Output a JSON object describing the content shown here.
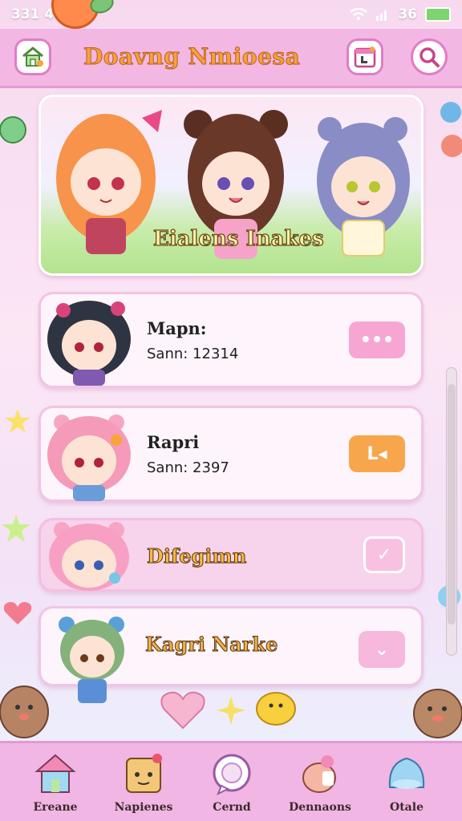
{
  "status_bar": {
    "time": "331 4",
    "signal_text": "36"
  },
  "header": {
    "title": "Doavng Nmioesa"
  },
  "banner": {
    "title": "Eialens Inakes"
  },
  "cards": [
    {
      "name": "Mapn:",
      "sub": "Sann: 12314",
      "action": "•••"
    },
    {
      "name": "Rapri",
      "sub": "Sann: 2397",
      "action": "L◂"
    },
    {
      "name": "Difegimn",
      "sub": "",
      "action": "✓"
    },
    {
      "name": "Kagri Narke",
      "sub": "",
      "action": "⌄"
    }
  ],
  "bottom_nav": [
    {
      "label": "Ereane",
      "icon": "house-icon"
    },
    {
      "label": "Napienes",
      "icon": "box-face-icon"
    },
    {
      "label": "Cernd",
      "icon": "chat-bubble-icon"
    },
    {
      "label": "Dennaons",
      "icon": "character-icon"
    },
    {
      "label": "Otale",
      "icon": "slime-icon"
    }
  ],
  "colors": {
    "accent": "#f3b7e4",
    "title": "#f6a13a",
    "action_orange": "#f8a64c"
  }
}
